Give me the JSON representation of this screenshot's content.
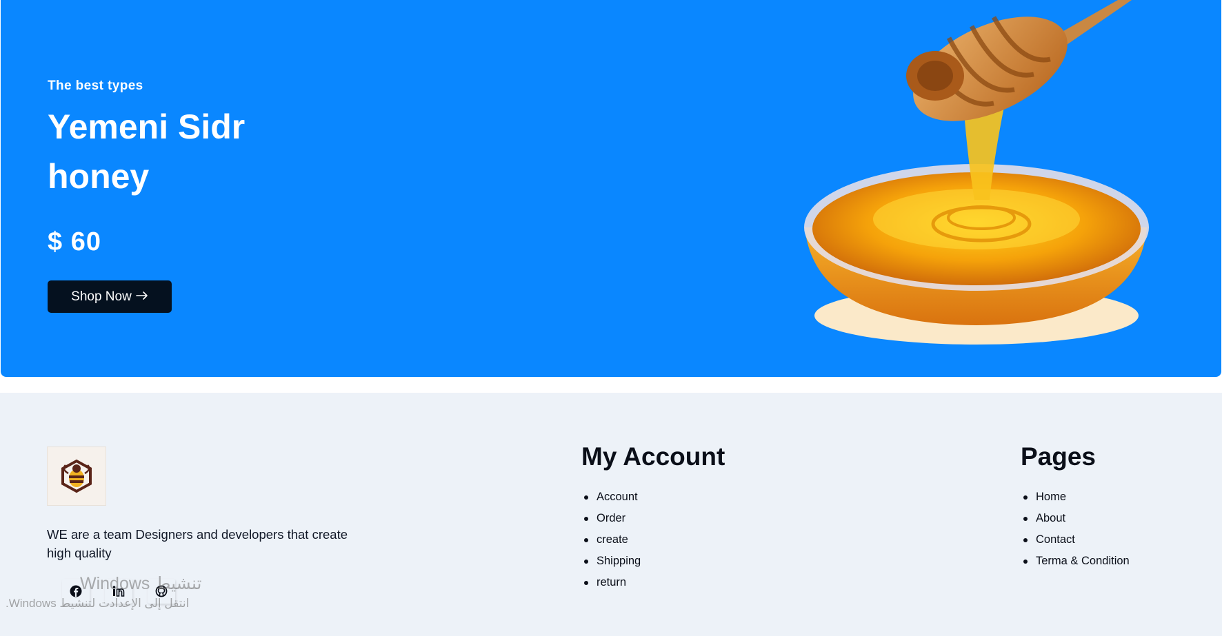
{
  "hero": {
    "subtitle": "The best types",
    "title": "Yemeni Sidr honey",
    "price": "$ 60",
    "button_label": "Shop Now",
    "background_color": "#0a87ff",
    "button_color": "#05111f",
    "product_image": "honey-bowl-with-dipper"
  },
  "footer": {
    "logo": "bee-logo",
    "description": "WE are a team Designers and developers that create high quality",
    "social": [
      {
        "icon": "facebook-icon"
      },
      {
        "icon": "linkedin-icon"
      },
      {
        "icon": "github-icon"
      }
    ],
    "account": {
      "title": "My Account",
      "items": [
        "Account",
        "Order",
        "create",
        "Shipping",
        "return"
      ]
    },
    "pages": {
      "title": "Pages",
      "items": [
        "Home",
        "About",
        "Contact",
        "Terma & Condition"
      ]
    },
    "background_color": "#edf2f8"
  },
  "watermark": {
    "title": "تنشيط Windows",
    "subtitle": "انتقل إلى الإعدادت لتنشيط Windows."
  }
}
